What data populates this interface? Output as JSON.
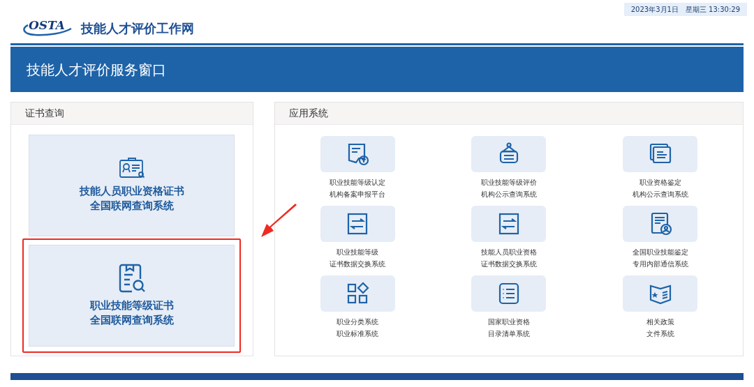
{
  "header": {
    "datetime": "2023年3月1日　星期三 13:30:29",
    "logo_text": "OSTA",
    "site_title": "技能人才评价工作网"
  },
  "banner": {
    "title": "技能人才评价服务窗口"
  },
  "certificate_panel": {
    "title": "证书查询",
    "cards": [
      {
        "lines": [
          "技能人员职业资格证书",
          "全国联网查询系统"
        ],
        "highlighted": false
      },
      {
        "lines": [
          "职业技能等级证书",
          "全国联网查询系统"
        ],
        "highlighted": true
      }
    ]
  },
  "apps_panel": {
    "title": "应用系统",
    "apps": [
      {
        "lines": [
          "职业技能等级认定",
          "机构备案申报平台"
        ]
      },
      {
        "lines": [
          "职业技能等级评价",
          "机构公示查询系统"
        ]
      },
      {
        "lines": [
          "职业资格鉴定",
          "机构公示查询系统"
        ]
      },
      {
        "lines": [
          "职业技能等级",
          "证书数据交换系统"
        ]
      },
      {
        "lines": [
          "技能人员职业资格",
          "证书数据交换系统"
        ]
      },
      {
        "lines": [
          "全国职业技能鉴定",
          "专用内部通信系统"
        ]
      },
      {
        "lines": [
          "职业分类系统",
          "职业标准系统"
        ]
      },
      {
        "lines": [
          "国家职业资格",
          "目录清单系统"
        ]
      },
      {
        "lines": [
          "相关政策",
          "文件系统"
        ]
      }
    ]
  }
}
